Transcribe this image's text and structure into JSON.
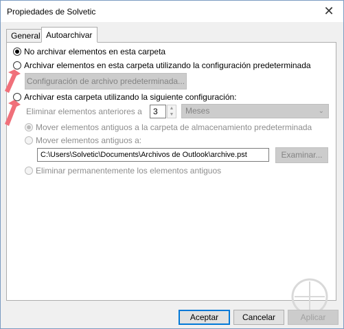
{
  "window": {
    "title": "Propiedades de Solvetic",
    "close_glyph": "✕"
  },
  "tabs": [
    {
      "label": "General",
      "active": false
    },
    {
      "label": "Autoarchivar",
      "active": true
    }
  ],
  "options": {
    "no_archive": {
      "label": "No archivar elementos en esta carpeta",
      "checked": true
    },
    "default_archive": {
      "label": "Archivar elementos en esta carpeta utilizando la configuración predeterminada",
      "checked": false
    },
    "default_settings_button": "Configuración de archivo predeterminada...",
    "custom_archive": {
      "label": "Archivar esta carpeta utilizando la siguiente configuración:",
      "checked": false
    }
  },
  "custom": {
    "older_than_label": "Eliminar elementos anteriores a",
    "older_than_value": "3",
    "unit_selected": "Meses",
    "move_default": {
      "label": "Mover elementos antiguos a la carpeta de almacenamiento predeterminada",
      "checked": true
    },
    "move_to": {
      "label": "Mover elementos antiguos a:",
      "checked": false
    },
    "path_value": "C:\\Users\\Solvetic\\Documents\\Archivos de Outlook\\archive.pst",
    "browse_button": "Examinar...",
    "delete_permanently": {
      "label": "Eliminar permanentemente los elementos antiguos",
      "checked": false
    }
  },
  "footer": {
    "ok": "Aceptar",
    "cancel": "Cancelar",
    "apply": "Aplicar"
  },
  "colors": {
    "arrow": "#f0707a",
    "accent": "#0078d7"
  }
}
